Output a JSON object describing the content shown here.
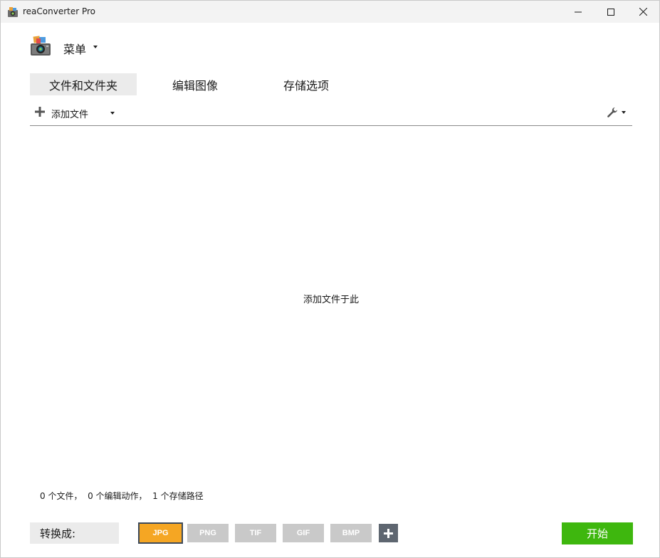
{
  "window": {
    "title": "reaConverter Pro"
  },
  "menu": {
    "label": "菜单"
  },
  "tabs": [
    {
      "label": "文件和文件夹",
      "active": true
    },
    {
      "label": "编辑图像",
      "active": false
    },
    {
      "label": "存储选项",
      "active": false
    }
  ],
  "toolbar": {
    "add_files_label": "添加文件"
  },
  "drop_area": {
    "hint": "添加文件于此"
  },
  "status": {
    "text": "0 个文件，  0 个编辑动作，  1 个存储路径"
  },
  "convert": {
    "label": "转换成:",
    "formats": [
      "JPG",
      "PNG",
      "TIF",
      "GIF",
      "BMP"
    ],
    "selected": "JPG",
    "start_label": "开始"
  },
  "colors": {
    "selected_format": "#f5a623",
    "start_button": "#3eb70e",
    "inactive_format": "#c9c9c9"
  }
}
